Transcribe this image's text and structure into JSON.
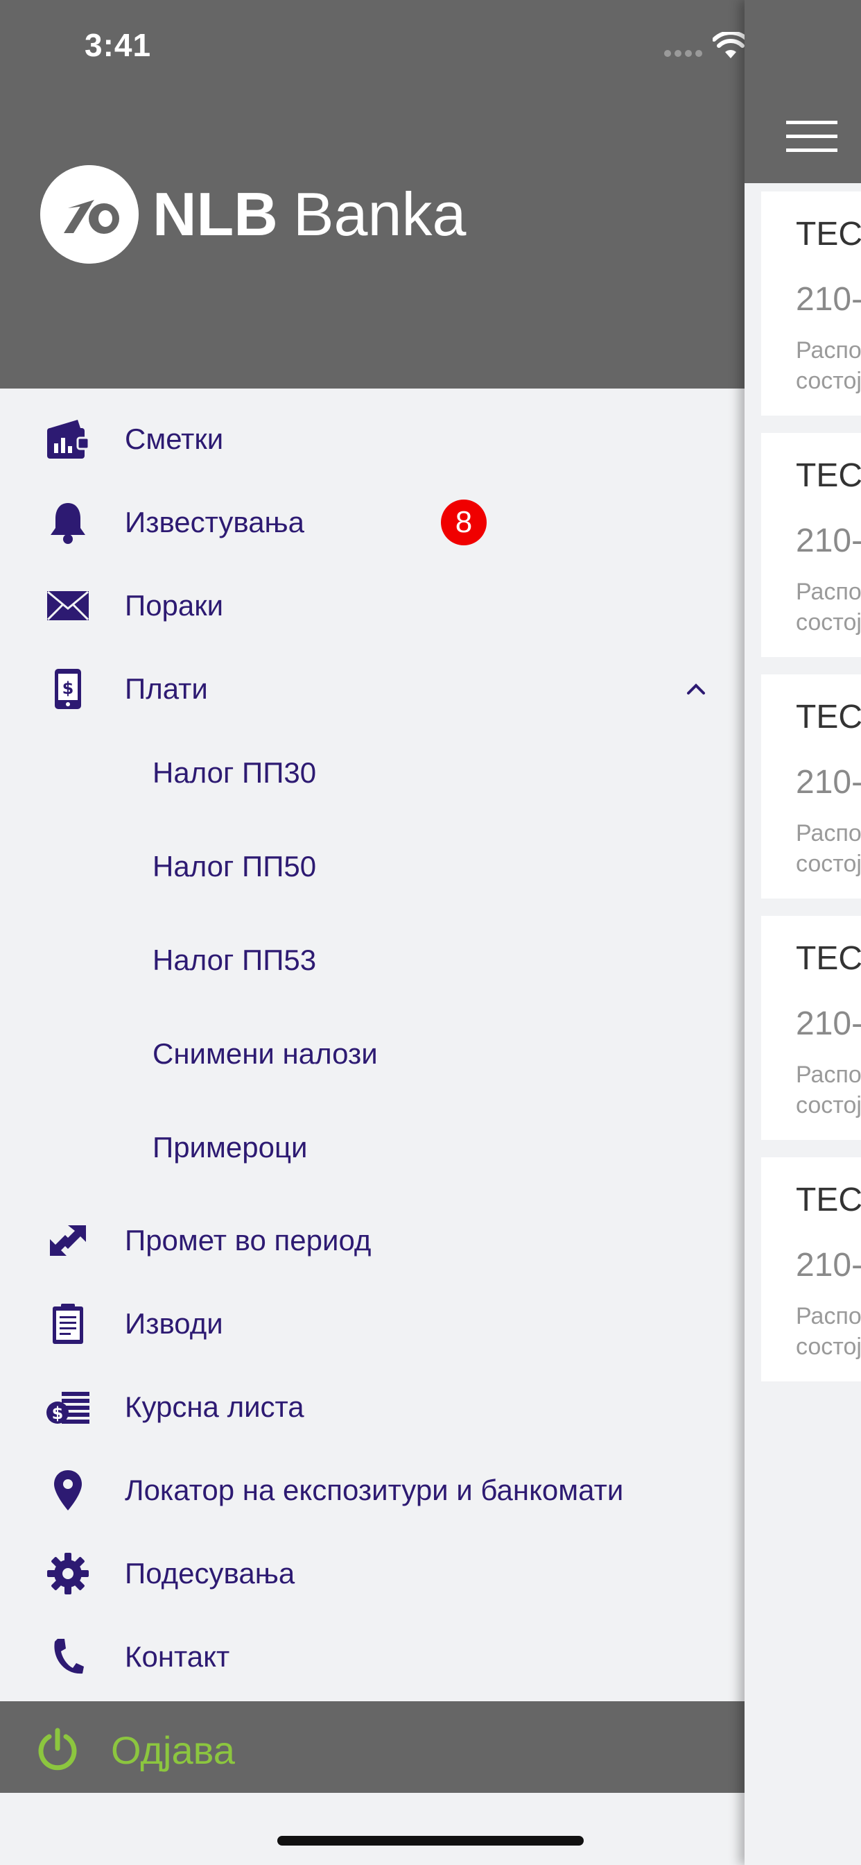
{
  "status_bar": {
    "time": "3:41"
  },
  "brand": {
    "part1": "NLB",
    "part2": "Banka"
  },
  "menu": {
    "items": [
      {
        "label": "Сметки",
        "icon": "accounts-icon"
      },
      {
        "label": "Известувања",
        "icon": "bell-icon",
        "badge": "8"
      },
      {
        "label": "Пораки",
        "icon": "envelope-icon"
      },
      {
        "label": "Плати",
        "icon": "payment-phone-icon"
      }
    ],
    "pay_submenu": [
      "Налог ПП30",
      "Налог ПП50",
      "Налог ПП53",
      "Снимени налози",
      "Примероци"
    ],
    "items2": [
      {
        "label": "Промет во период",
        "icon": "transfer-arrows-icon"
      },
      {
        "label": "Изводи",
        "icon": "clipboard-icon"
      },
      {
        "label": "Курсна листа",
        "icon": "exchange-rate-icon"
      },
      {
        "label": "Локатор на експозитури и банкомати",
        "icon": "location-pin-icon"
      },
      {
        "label": "Подесувања",
        "icon": "gear-icon"
      },
      {
        "label": "Контакт",
        "icon": "phone-icon"
      }
    ]
  },
  "logout": {
    "label": "Одјава"
  },
  "main": {
    "cards": [
      {
        "title": "ТЕСТ",
        "number": "210-",
        "desc1": "Распол",
        "desc2": "состој"
      },
      {
        "title": "ТЕСТ",
        "number": "210-",
        "desc1": "Распол",
        "desc2": "состој"
      },
      {
        "title": "ТЕСТ",
        "number": "210-",
        "desc1": "Распол",
        "desc2": "состој"
      },
      {
        "title": "ТЕСТ",
        "number": "210-",
        "desc1": "Распол",
        "desc2": "состој"
      },
      {
        "title": "ТЕСТ",
        "number": "210-",
        "desc1": "Распол",
        "desc2": "состој"
      }
    ]
  },
  "colors": {
    "header": "#666666",
    "menu_text": "#2d1a72",
    "badge": "#f00000",
    "logout": "#8cc63f",
    "background": "#f1f2f4"
  }
}
